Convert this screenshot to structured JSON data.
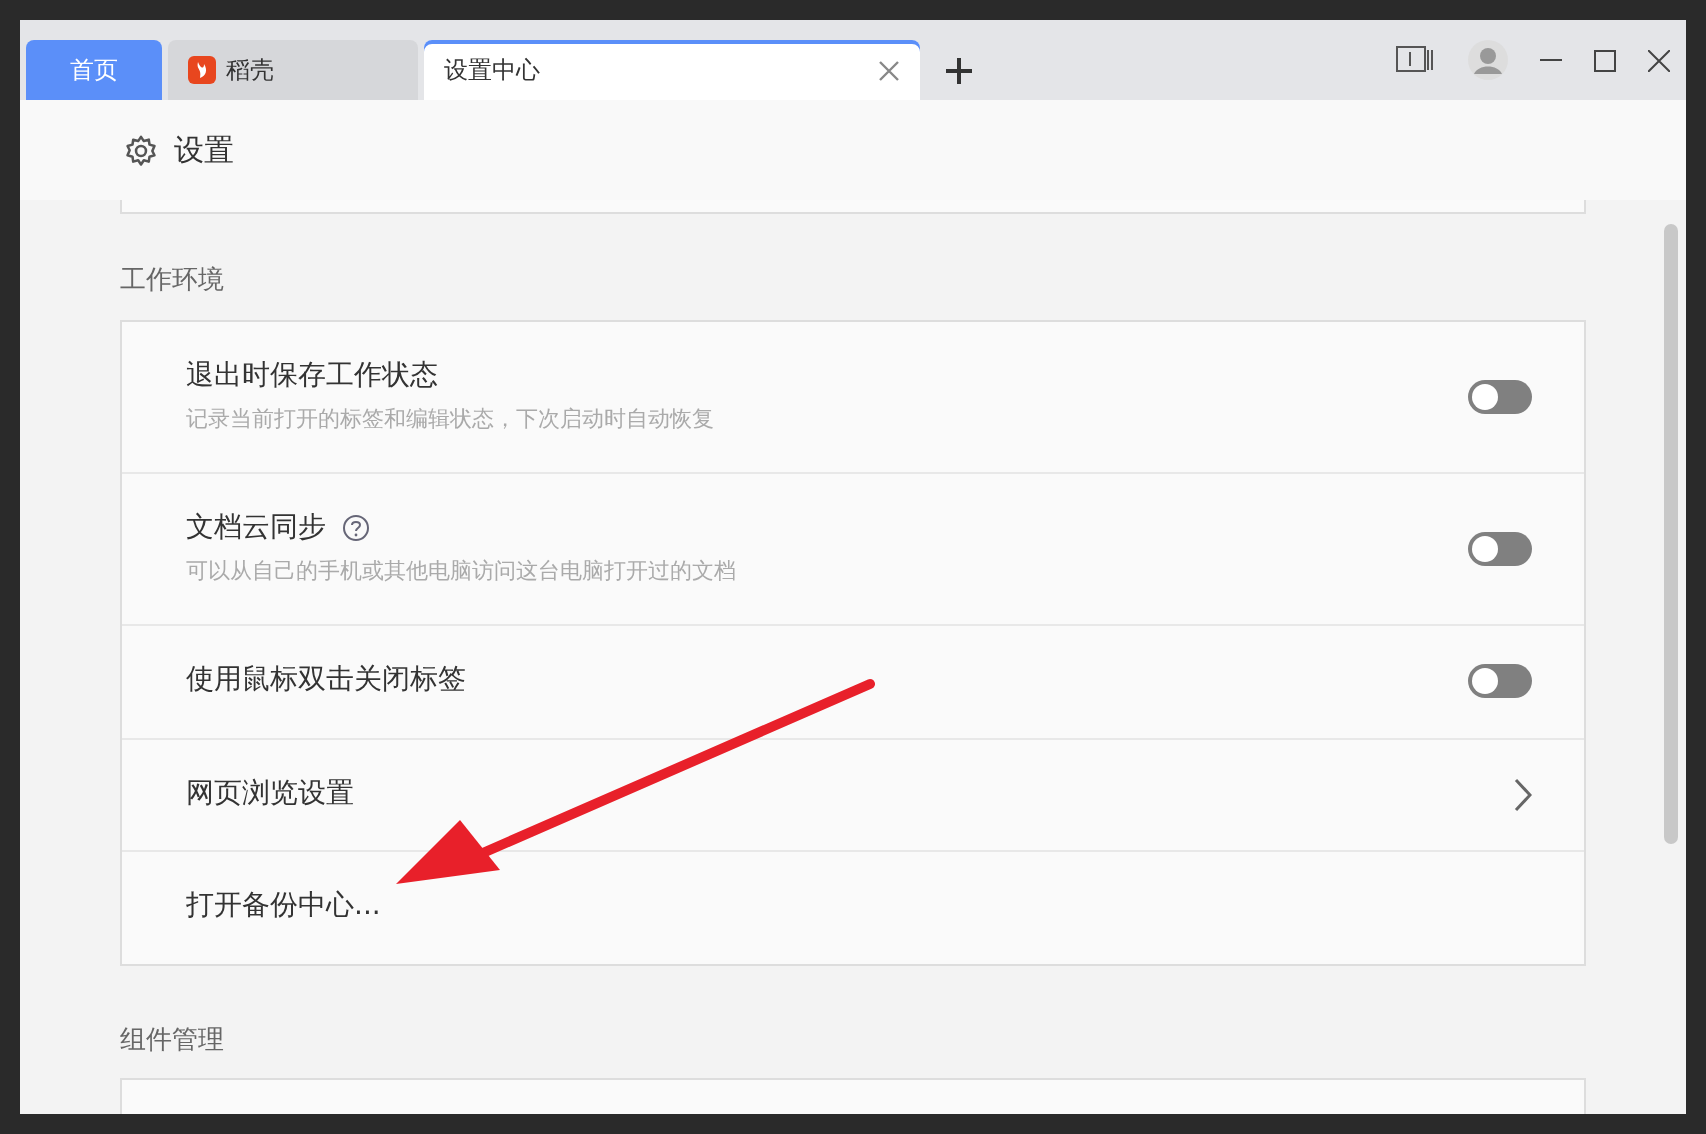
{
  "tabs": [
    {
      "label": "首页",
      "kind": "home",
      "selected": false
    },
    {
      "label": "稻壳",
      "kind": "docer",
      "selected": false
    },
    {
      "label": "设置中心",
      "kind": "page",
      "selected": true
    }
  ],
  "header": {
    "title": "设置"
  },
  "sections": [
    {
      "title": "工作环境",
      "rows": [
        {
          "kind": "toggle",
          "title": "退出时保存工作状态",
          "subtitle": "记录当前打开的标签和编辑状态，下次启动时自动恢复",
          "on": false,
          "help": false
        },
        {
          "kind": "toggle",
          "title": "文档云同步",
          "subtitle": "可以从自己的手机或其他电脑访问这台电脑打开过的文档",
          "on": false,
          "help": true
        },
        {
          "kind": "toggle",
          "title": "使用鼠标双击关闭标签",
          "on": false,
          "help": false
        },
        {
          "kind": "link",
          "title": "网页浏览设置"
        },
        {
          "kind": "action",
          "title": "打开备份中心..."
        }
      ]
    },
    {
      "title": "组件管理"
    }
  ]
}
